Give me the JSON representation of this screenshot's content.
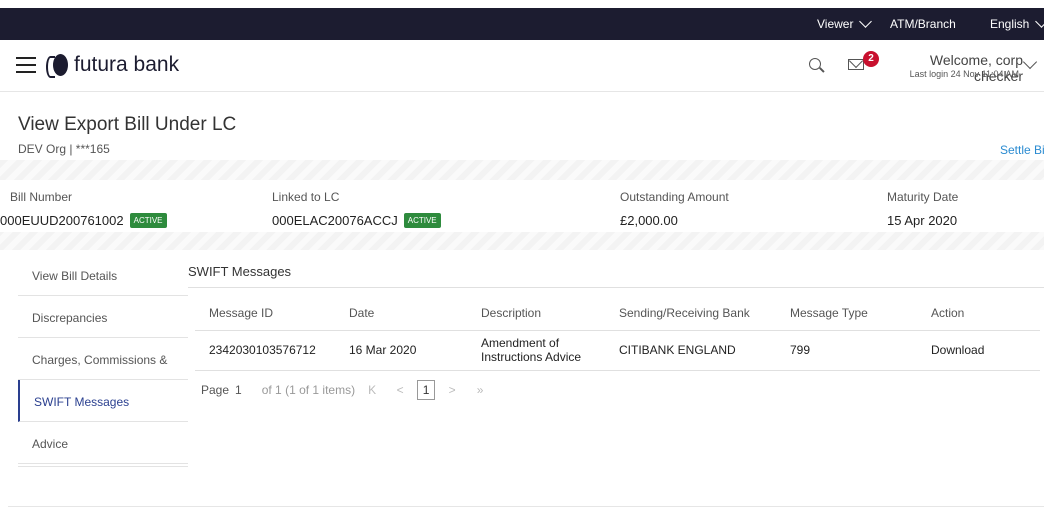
{
  "topbar": {
    "viewer": "Viewer",
    "atm_branch": "ATM/Branch",
    "language": "English"
  },
  "header": {
    "brand": "futura bank",
    "notifications_count": "2",
    "welcome": "Welcome, corp checker",
    "last_login": "Last login 24 Nov 11:04 AM"
  },
  "page": {
    "title": "View Export Bill Under LC",
    "subtitle": "DEV Org | ***165",
    "settle_link": "Settle Bill"
  },
  "summary": {
    "bill_number_label": "Bill Number",
    "bill_number": "000EUUD200761002",
    "bill_status": "ACTIVE",
    "linked_lc_label": "Linked to LC",
    "linked_lc": "000ELAC20076ACCJ",
    "linked_lc_status": "ACTIVE",
    "outstanding_label": "Outstanding Amount",
    "outstanding": "£2,000.00",
    "maturity_label": "Maturity Date",
    "maturity": "15 Apr 2020"
  },
  "sidebar": {
    "items": [
      {
        "label": "View Bill Details"
      },
      {
        "label": "Discrepancies"
      },
      {
        "label": "Charges, Commissions &"
      },
      {
        "label": "SWIFT Messages"
      },
      {
        "label": "Advice"
      }
    ]
  },
  "swift": {
    "title": "SWIFT Messages",
    "columns": [
      "Message ID",
      "Date",
      "Description",
      "Sending/Receiving Bank",
      "Message Type",
      "Action"
    ],
    "rows": [
      {
        "message_id": "2342030103576712",
        "date": "16 Mar 2020",
        "description": "Amendment of Instructions Advice",
        "bank": "CITIBANK ENGLAND",
        "type": "799",
        "action": "Download"
      }
    ],
    "pager": {
      "page_label": "Page",
      "page_value": "1",
      "of_text": "of 1  (1 of 1 items)",
      "current": "1"
    }
  }
}
